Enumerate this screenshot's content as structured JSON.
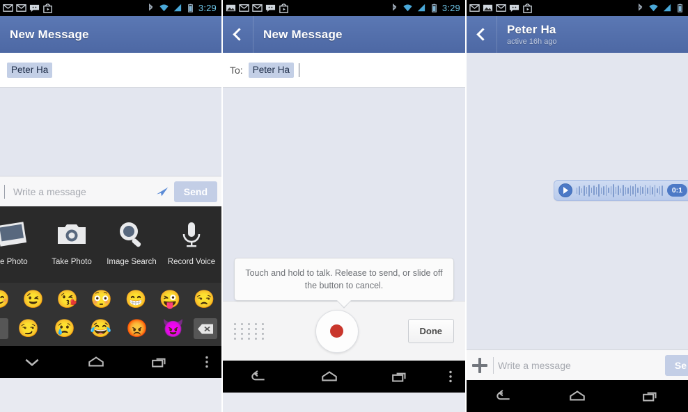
{
  "status_bar": {
    "time": "3:29",
    "left_icons_p1": [
      "gmail-icon",
      "gmail-icon",
      "messenger-icon",
      "play-store-icon"
    ],
    "left_icons_p2": [
      "photo-icon",
      "gmail-icon",
      "gmail-icon",
      "messenger-icon",
      "play-store-icon"
    ],
    "left_icons_p3": [
      "gmail-icon",
      "photo-icon",
      "gmail-icon",
      "messenger-icon",
      "play-store-icon"
    ],
    "right_icons": [
      "bluetooth-icon",
      "wifi-icon",
      "signal-icon",
      "battery-icon"
    ]
  },
  "panel1": {
    "appbar": {
      "title": "New Message"
    },
    "recipient": {
      "token": "Peter Ha"
    },
    "composer": {
      "placeholder": "Write a message",
      "value": "",
      "send_label": "Send"
    },
    "attachment_tray": [
      {
        "label": "se Photo",
        "icon": "photo-stack-icon"
      },
      {
        "label": "Take Photo",
        "icon": "camera-icon"
      },
      {
        "label": "Image Search",
        "icon": "magnifier-icon"
      },
      {
        "label": "Record Voice",
        "icon": "microphone-icon"
      }
    ],
    "emoji_keyboard": {
      "row1": [
        "😊",
        "😉",
        "😘",
        "😳",
        "😁",
        "😜",
        "😒"
      ],
      "row2": [
        "😏",
        "😢",
        "😂",
        "😡",
        "😈"
      ],
      "backspace_icon": "backspace-icon"
    },
    "navbar": [
      "hide-keyboard-icon",
      "home-icon",
      "recents-icon",
      "overflow-menu-icon"
    ]
  },
  "panel2": {
    "appbar": {
      "title": "New Message",
      "back_icon": "back-chevron-icon"
    },
    "recipient": {
      "label": "To:",
      "token": "Peter Ha"
    },
    "tooltip": "Touch and hold to talk. Release to send, or slide off the button to cancel.",
    "recorder": {
      "keyboard_toggle_icon": "dot-grid-icon",
      "record_icon": "record-button-icon",
      "done_label": "Done"
    },
    "navbar": [
      "back-icon",
      "home-icon",
      "recents-icon",
      "overflow-menu-icon"
    ]
  },
  "panel3": {
    "appbar": {
      "title": "Peter Ha",
      "subtitle": "active 16h ago",
      "back_icon": "back-chevron-icon"
    },
    "voice_message": {
      "play_icon": "play-icon",
      "duration": "0:1"
    },
    "composer": {
      "plus_icon": "plus-icon",
      "placeholder": "Write a message",
      "value": "",
      "send_label": "Se"
    },
    "navbar": [
      "back-icon",
      "home-icon",
      "recents-icon"
    ]
  },
  "colors": {
    "appbar_blue": "#5272ad",
    "thread_bg": "#e3e6ef",
    "tray_bg": "#2a2a2a",
    "keyboard_bg": "#333333",
    "send_disabled": "#c3cee6",
    "record_red": "#c9362c",
    "accent_blue": "#4c79c6",
    "clock_blue": "#6ec6e8"
  }
}
